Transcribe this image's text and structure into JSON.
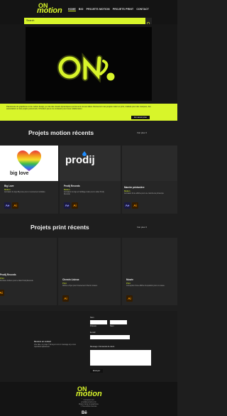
{
  "header": {
    "logo_text": "motion",
    "logo_sub": "...",
    "nav": [
      "HOME",
      "BIO",
      "PROJETS MOTION",
      "PROJETS PRINT",
      "CONTACT"
    ],
    "search_placeholder": "Search"
  },
  "intro": {
    "text": "Passionnée de graphisme et de motion design, je crée des visuels dynamiques qui donnent vie aux idées. Découvrez mes projets motion et print, réalisés pour des marques, des associations et des projets personnels. N'hésitez pas à me contacter pour toute collaboration.",
    "button": "En savoir plus"
  },
  "motion": {
    "title": "Projets motion récents",
    "dropdown": "Voir plus ▾",
    "cards": [
      {
        "title": "Big Love",
        "tag": "Motion",
        "desc": "Animation du logo Big Love pour un événement solidaire.",
        "apps": [
          "Ae",
          "Ai"
        ],
        "image_text": "big love"
      },
      {
        "title": "Prodij Records",
        "tag": "Motion",
        "desc": "Animation du logo et habillage vidéo pour le label Prodij Records.",
        "apps": [
          "Ae",
          "Ai"
        ],
        "image_text": "prodij"
      },
      {
        "title": "Marche printanière",
        "tag": "Motion",
        "desc": "Animation d'une affiche pour une marche de printemps.",
        "apps": [
          "Ae",
          "Ai"
        ],
        "image_text": ""
      }
    ]
  },
  "print": {
    "title": "Projets print récents",
    "dropdown": "Voir plus ▾",
    "cards": [
      {
        "title": "Prodij Records",
        "tag": "Print",
        "desc": "Pochette d'album pour le label Prodij Records.",
        "apps": [
          "Ai"
        ]
      },
      {
        "title": "Chemin Lisieux",
        "tag": "Print",
        "desc": "Affiche et flyer pour l'événement Chemin Lisieux.",
        "apps": [
          "Ai"
        ]
      },
      {
        "title": "Musée",
        "tag": "Print",
        "desc": "Conception d'une affiche d'exposition pour un musée.",
        "apps": [
          "Ai"
        ]
      }
    ]
  },
  "contact": {
    "left_title": "Restons en contact",
    "left_text": "Une idée, un projet ? Envoyez-moi un message et je vous répondrai rapidement.",
    "name_label": "Nom",
    "first_label": "Prénom",
    "last_label": "Nom",
    "email_label": "E-mail",
    "message_label": "Message / Demande de devis",
    "submit": "Envoyer"
  },
  "footer": {
    "logo_text": "motion",
    "logo_sub": "...",
    "lines": [
      "Contactez-moi",
      "email@exemple.com",
      "Motion design & graphisme",
      "© Tous droits réservés"
    ],
    "behance": "Bē"
  }
}
